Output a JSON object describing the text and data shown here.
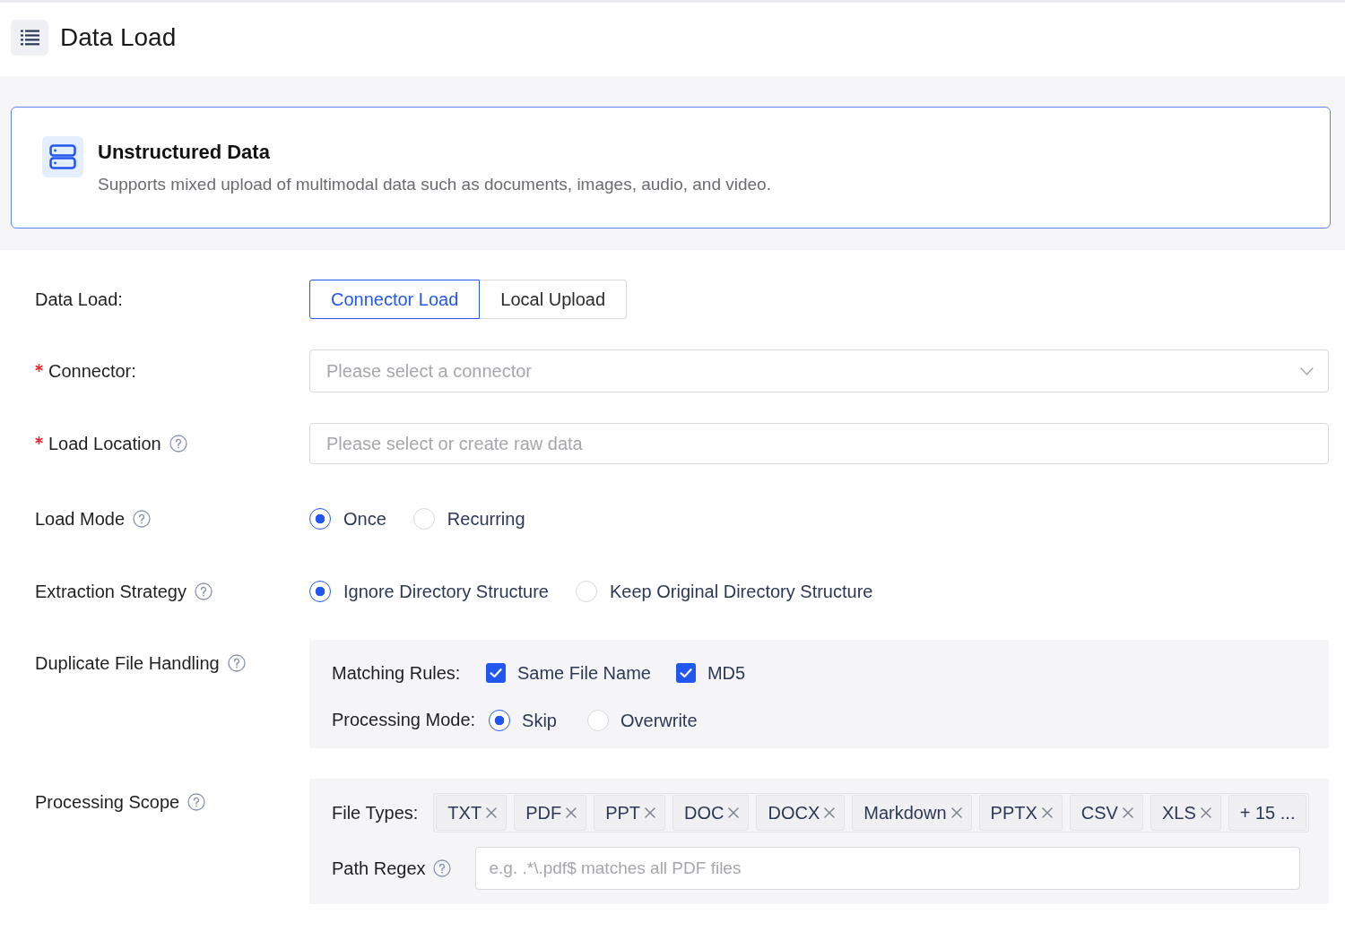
{
  "page_header": {
    "title": "Data Load"
  },
  "source_card": {
    "title": "Unstructured Data",
    "description": "Supports mixed upload of multimodal data such as documents, images, audio, and video."
  },
  "form": {
    "fields": [
      {
        "kind": "segmented",
        "label": "Data Load:",
        "required": false,
        "help": false,
        "options": [
          {
            "label": "Connector Load",
            "selected": true
          },
          {
            "label": "Local Upload",
            "selected": false
          }
        ]
      },
      {
        "kind": "select",
        "label": "Connector:",
        "required": true,
        "help": false,
        "placeholder": "Please select a connector"
      },
      {
        "kind": "input",
        "label": "Load Location",
        "required": true,
        "help": true,
        "placeholder": "Please select or create raw data"
      },
      {
        "kind": "radio",
        "label": "Load Mode",
        "required": false,
        "help": true,
        "options": [
          {
            "label": "Once",
            "selected": true
          },
          {
            "label": "Recurring",
            "selected": false
          }
        ]
      },
      {
        "kind": "radio",
        "label": "Extraction Strategy",
        "required": false,
        "help": true,
        "options": [
          {
            "label": "Ignore Directory Structure",
            "selected": true
          },
          {
            "label": "Keep Original Directory Structure",
            "selected": false
          }
        ]
      },
      {
        "kind": "panel",
        "label": "Duplicate File Handling",
        "required": false,
        "help": true,
        "rows": [
          {
            "kind": "checkboxes",
            "label": "Matching Rules:",
            "help": false,
            "options": [
              {
                "label": "Same File Name",
                "checked": true
              },
              {
                "label": "MD5",
                "checked": true
              }
            ]
          },
          {
            "kind": "radio",
            "label": "Processing Mode:",
            "help": false,
            "options": [
              {
                "label": "Skip",
                "selected": true
              },
              {
                "label": "Overwrite",
                "selected": false
              }
            ]
          }
        ]
      },
      {
        "kind": "panel",
        "label": "Processing Scope",
        "required": false,
        "help": true,
        "rows": [
          {
            "kind": "tags",
            "label": "File Types:",
            "help": false,
            "tags": [
              "TXT",
              "PDF",
              "PPT",
              "DOC",
              "DOCX",
              "Markdown",
              "PPTX",
              "CSV",
              "XLS"
            ],
            "more": "+ 15 ..."
          },
          {
            "kind": "input",
            "label": "Path Regex",
            "help": true,
            "placeholder": "e.g. .*\\.pdf$ matches all PDF files"
          }
        ]
      }
    ]
  }
}
